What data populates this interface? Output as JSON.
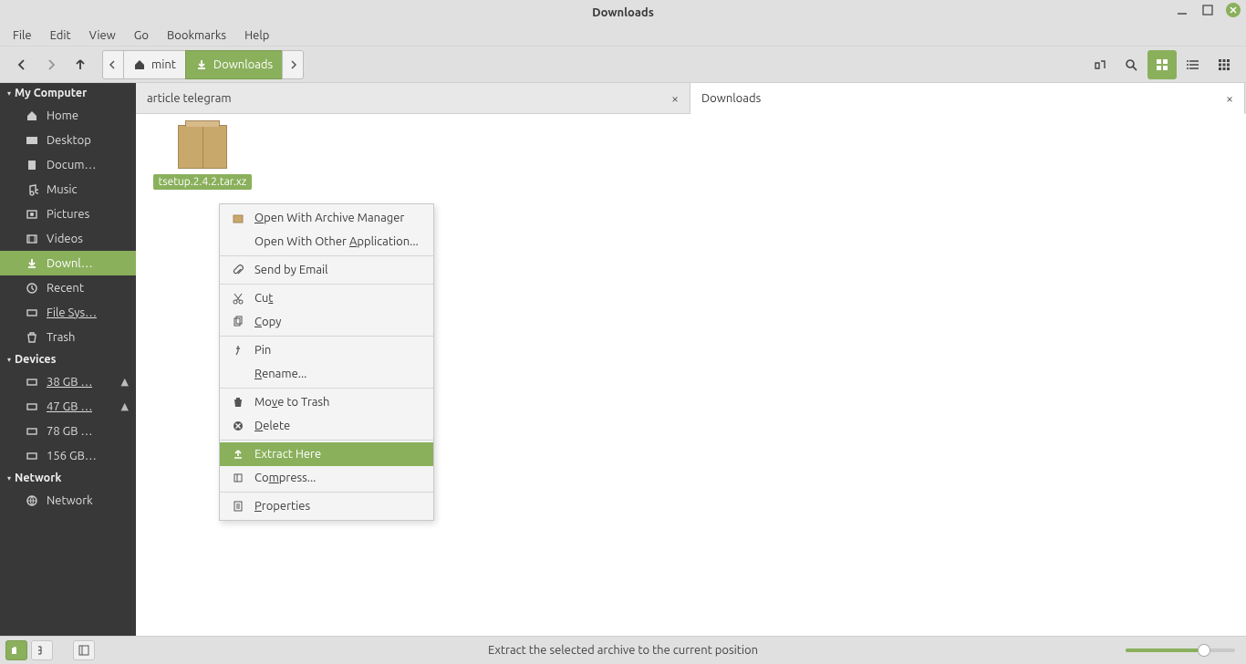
{
  "window": {
    "title": "Downloads"
  },
  "menubar": {
    "items": [
      "File",
      "Edit",
      "View",
      "Go",
      "Bookmarks",
      "Help"
    ]
  },
  "pathbar": {
    "home": "mint",
    "current": "Downloads"
  },
  "tabs": [
    {
      "label": "article telegram"
    },
    {
      "label": "Downloads"
    }
  ],
  "sidebar": {
    "section_computer": "My Computer",
    "home": "Home",
    "desktop": "Desktop",
    "documents": "Docum…",
    "music": "Music",
    "pictures": "Pictures",
    "videos": "Videos",
    "downloads": "Downl…",
    "recent": "Recent",
    "filesystem": "File Sys…",
    "trash": "Trash",
    "section_devices": "Devices",
    "vol1": "38 GB …",
    "vol2": "47 GB …",
    "vol3": "78 GB …",
    "vol4": "156 GB…",
    "section_network": "Network",
    "network": "Network"
  },
  "file": {
    "name": "tsetup.2.4.2.tar.xz"
  },
  "context_menu": {
    "open_with_archive": "Open With Archive Manager",
    "open_with_other": "Open With Other Application...",
    "send_by_email": "Send by Email",
    "cut": "Cut",
    "copy": "Copy",
    "pin": "Pin",
    "rename": "Rename...",
    "move_to_trash": "Move to Trash",
    "delete": "Delete",
    "extract_here": "Extract Here",
    "compress": "Compress...",
    "properties": "Properties"
  },
  "statusbar": {
    "text": "Extract the selected archive to the current position"
  }
}
